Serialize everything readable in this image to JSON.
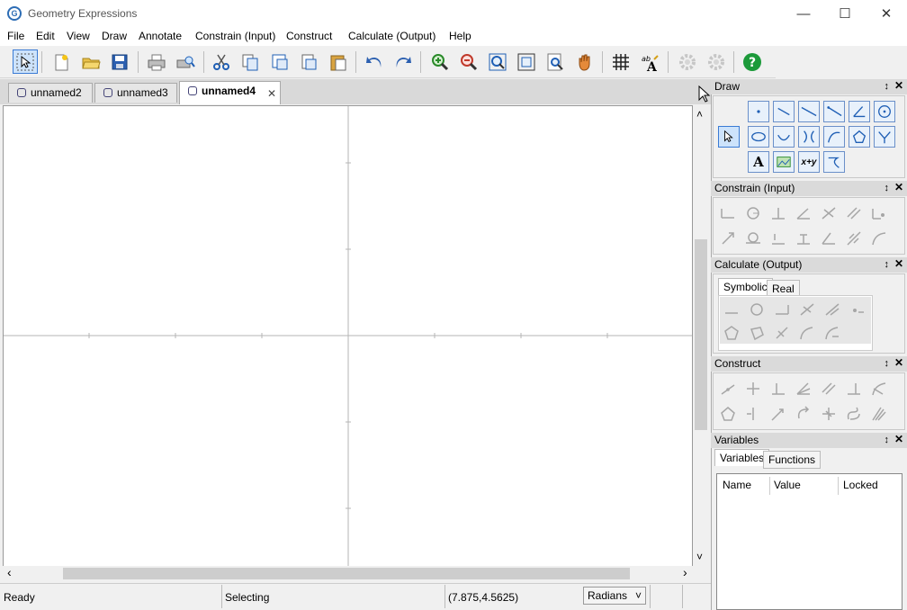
{
  "app": {
    "title": "Geometry Expressions",
    "logo_letter": "G"
  },
  "window": {
    "minimize": "—",
    "maximize": "☐",
    "close": "✕"
  },
  "menu": [
    "File",
    "Edit",
    "View",
    "Draw",
    "Annotate",
    "Constrain (Input)",
    "Construct",
    "Calculate (Output)",
    "Help"
  ],
  "toolbar": {
    "buttons": [
      "select",
      "new",
      "open",
      "save",
      "print",
      "print-preview",
      "cut",
      "copy",
      "copy-as",
      "paste-special",
      "paste",
      "undo",
      "redo",
      "zoom-in",
      "zoom-out",
      "zoom-fit",
      "zoom-box",
      "zoom-window",
      "pan",
      "grid",
      "font",
      "calc1",
      "calc2",
      "help"
    ],
    "help_glyph": "?"
  },
  "tabs": [
    {
      "label": "unnamed2",
      "active": false
    },
    {
      "label": "unnamed3",
      "active": false
    },
    {
      "label": "unnamed4",
      "active": true
    }
  ],
  "tab_close": "✕",
  "scroll": {
    "up": "˄",
    "down": "˅",
    "left": "‹",
    "right": "›"
  },
  "status": {
    "ready": "Ready",
    "mode": "Selecting",
    "coords": "(7.875,4.5625)",
    "angle_unit": "Radians",
    "dropdown_glyph": "˅"
  },
  "panels": {
    "draw": {
      "title": "Draw",
      "text_tool": "A",
      "expr_tool": "x+y"
    },
    "constrain": {
      "title": "Constrain (Input)"
    },
    "calculate": {
      "title": "Calculate (Output)",
      "tabs": [
        "Symbolic",
        "Real"
      ]
    },
    "construct": {
      "title": "Construct"
    },
    "variables": {
      "title": "Variables",
      "tabs": [
        "Variables",
        "Functions"
      ],
      "columns": [
        "Name",
        "Value",
        "Locked"
      ]
    }
  },
  "panel_controls": {
    "pin": "↕",
    "close": "✕"
  },
  "colors": {
    "accent": "#1f5fb5",
    "axis": "#b4b4b4",
    "help_green": "#1c9a3a"
  }
}
